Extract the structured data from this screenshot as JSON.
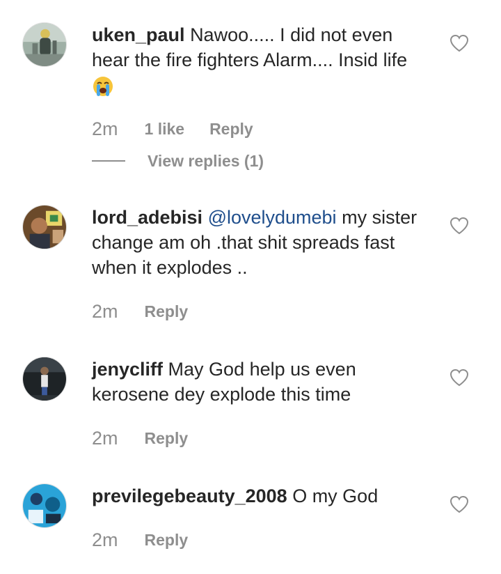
{
  "comments": [
    {
      "username": "uken_paul",
      "text": "Nawoo..... I did not even hear the fire fighters Alarm.... Insid life",
      "emoji": "crying-face",
      "time": "2m",
      "likes": "1 like",
      "reply_label": "Reply",
      "view_replies": "View replies (1)"
    },
    {
      "username": "lord_adebisi",
      "mention": "@lovelydumebi",
      "text": "my sister change am oh .that shit spreads fast when it explodes ..",
      "time": "2m",
      "reply_label": "Reply"
    },
    {
      "username": "jenycliff",
      "text": "May God help us even kerosene dey explode this time",
      "time": "2m",
      "reply_label": "Reply"
    },
    {
      "username": "previlegebeauty_2008",
      "text": "O my God",
      "time": "2m",
      "reply_label": "Reply"
    }
  ],
  "colors": {
    "username": "#262626",
    "text": "#262626",
    "meta": "#8e8e8e",
    "mention": "#1f4e8c"
  }
}
